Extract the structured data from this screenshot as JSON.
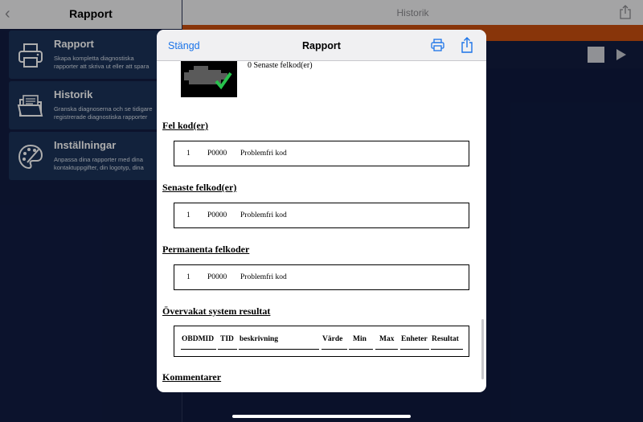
{
  "sidebar": {
    "title": "Rapport",
    "back_icon": "chevron-left-icon",
    "items": [
      {
        "title": "Rapport",
        "desc": "Skapa kompletta diagnostiska\nrapporter att skriva ut eller att spara",
        "icon": "printer-icon"
      },
      {
        "title": "Historik",
        "desc": "Granska diagnoserna och se tidigare\nregistrerade diagnostiska rapporter",
        "icon": "folder-icon"
      },
      {
        "title": "Inställningar",
        "desc": "Anpassa dina rapporter med dina\nkontaktuppgifter, din logotyp, dina",
        "icon": "palette-icon"
      }
    ]
  },
  "background": {
    "title": "Historik",
    "accent": "#c94f0f"
  },
  "modal": {
    "done": "Stängd",
    "title": "Rapport",
    "print_icon": "printer-icon",
    "share_icon": "share-icon"
  },
  "report": {
    "latest_count": "0 Senaste felkod(er)",
    "sections": [
      {
        "title": "Fel kod(er)",
        "row": {
          "num": "1",
          "code": "P0000",
          "desc": "Problemfri kod"
        }
      },
      {
        "title": "Senaste felkod(er)",
        "row": {
          "num": "1",
          "code": "P0000",
          "desc": "Problemfri kod"
        }
      },
      {
        "title": "Permanenta felkoder",
        "row": {
          "num": "1",
          "code": "P0000",
          "desc": "Problemfri kod"
        }
      }
    ],
    "monitor_title": "Övervakat system resultat",
    "monitor_columns": [
      "OBDMID",
      "TID",
      "beskrivning",
      "Värde",
      "Min",
      "Max",
      "Enheter",
      "Resultat"
    ],
    "comments_title": "Kommentarer"
  }
}
